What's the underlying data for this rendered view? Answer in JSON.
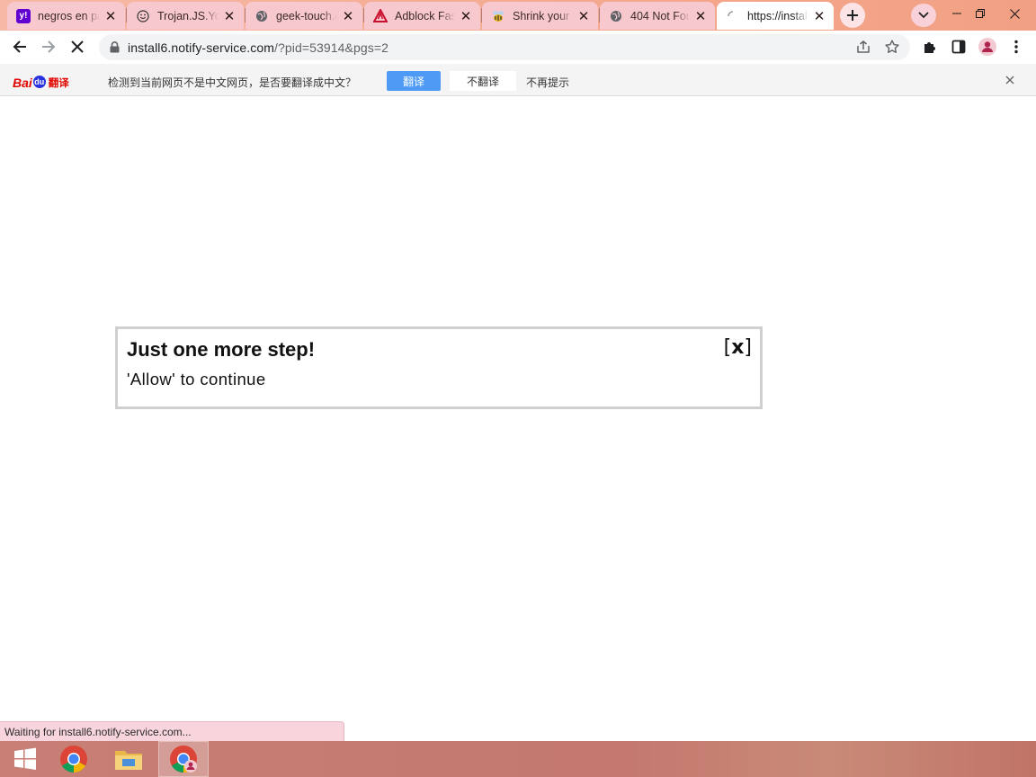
{
  "tabs": [
    {
      "title": "negros en pa",
      "icon": "yahoo-icon"
    },
    {
      "title": "Trojan.JS.You",
      "icon": "smiley-icon"
    },
    {
      "title": "geek-touch.c",
      "icon": "globe-icon"
    },
    {
      "title": "Adblock Fast",
      "icon": "adblock-icon"
    },
    {
      "title": "Shrink your f",
      "icon": "bee-icon"
    },
    {
      "title": "404 Not Foun",
      "icon": "globe-icon"
    },
    {
      "title": "https://instal",
      "icon": "loading-icon",
      "active": true
    }
  ],
  "toolbar": {
    "url_host": "install6.notify-service.com",
    "url_path": "/?pid=53914&pgs=2"
  },
  "translate_bar": {
    "logo_bai": "Bai",
    "logo_du": "du",
    "logo_fanyi": "翻译",
    "message": "检测到当前网页不是中文网页，是否要翻译成中文？",
    "translate_label": "翻译",
    "dont_translate_label": "不翻译",
    "never_label": "不再提示"
  },
  "dialog": {
    "title": "Just one more step!",
    "subtitle": "'Allow' to continue",
    "close_label": "x"
  },
  "status_text": "Waiting for install6.notify-service.com...",
  "colors": {
    "tab_strip": "#f4a98e",
    "tab_inactive": "#f8c8cf",
    "translate_button": "#4e9af5",
    "taskbar": "#c4786e"
  }
}
